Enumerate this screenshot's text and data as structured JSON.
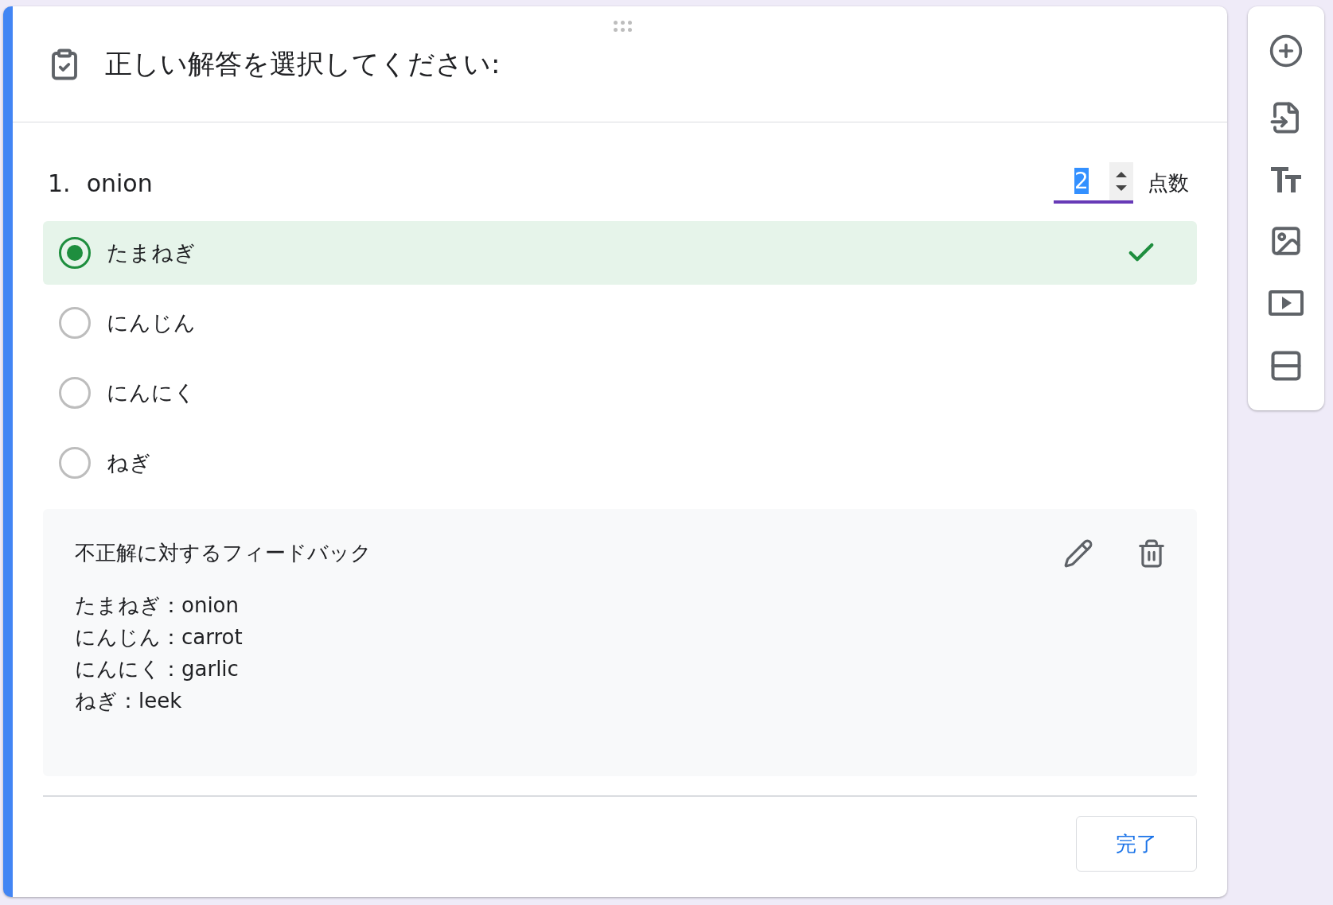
{
  "header": {
    "title": "正しい解答を選択してください:"
  },
  "question": {
    "number": "1.",
    "text": "onion",
    "points": {
      "value": "2",
      "label": "点数"
    }
  },
  "options": [
    {
      "label": "たまねぎ",
      "selected": true,
      "correct": true
    },
    {
      "label": "にんじん",
      "selected": false,
      "correct": false
    },
    {
      "label": "にんにく",
      "selected": false,
      "correct": false
    },
    {
      "label": "ねぎ",
      "selected": false,
      "correct": false
    }
  ],
  "feedback": {
    "title": "不正解に対するフィードバック",
    "lines": [
      "たまねぎ：onion",
      "にんじん：carrot",
      "にんにく：garlic",
      "ねぎ：leek"
    ]
  },
  "done_button": "完了"
}
